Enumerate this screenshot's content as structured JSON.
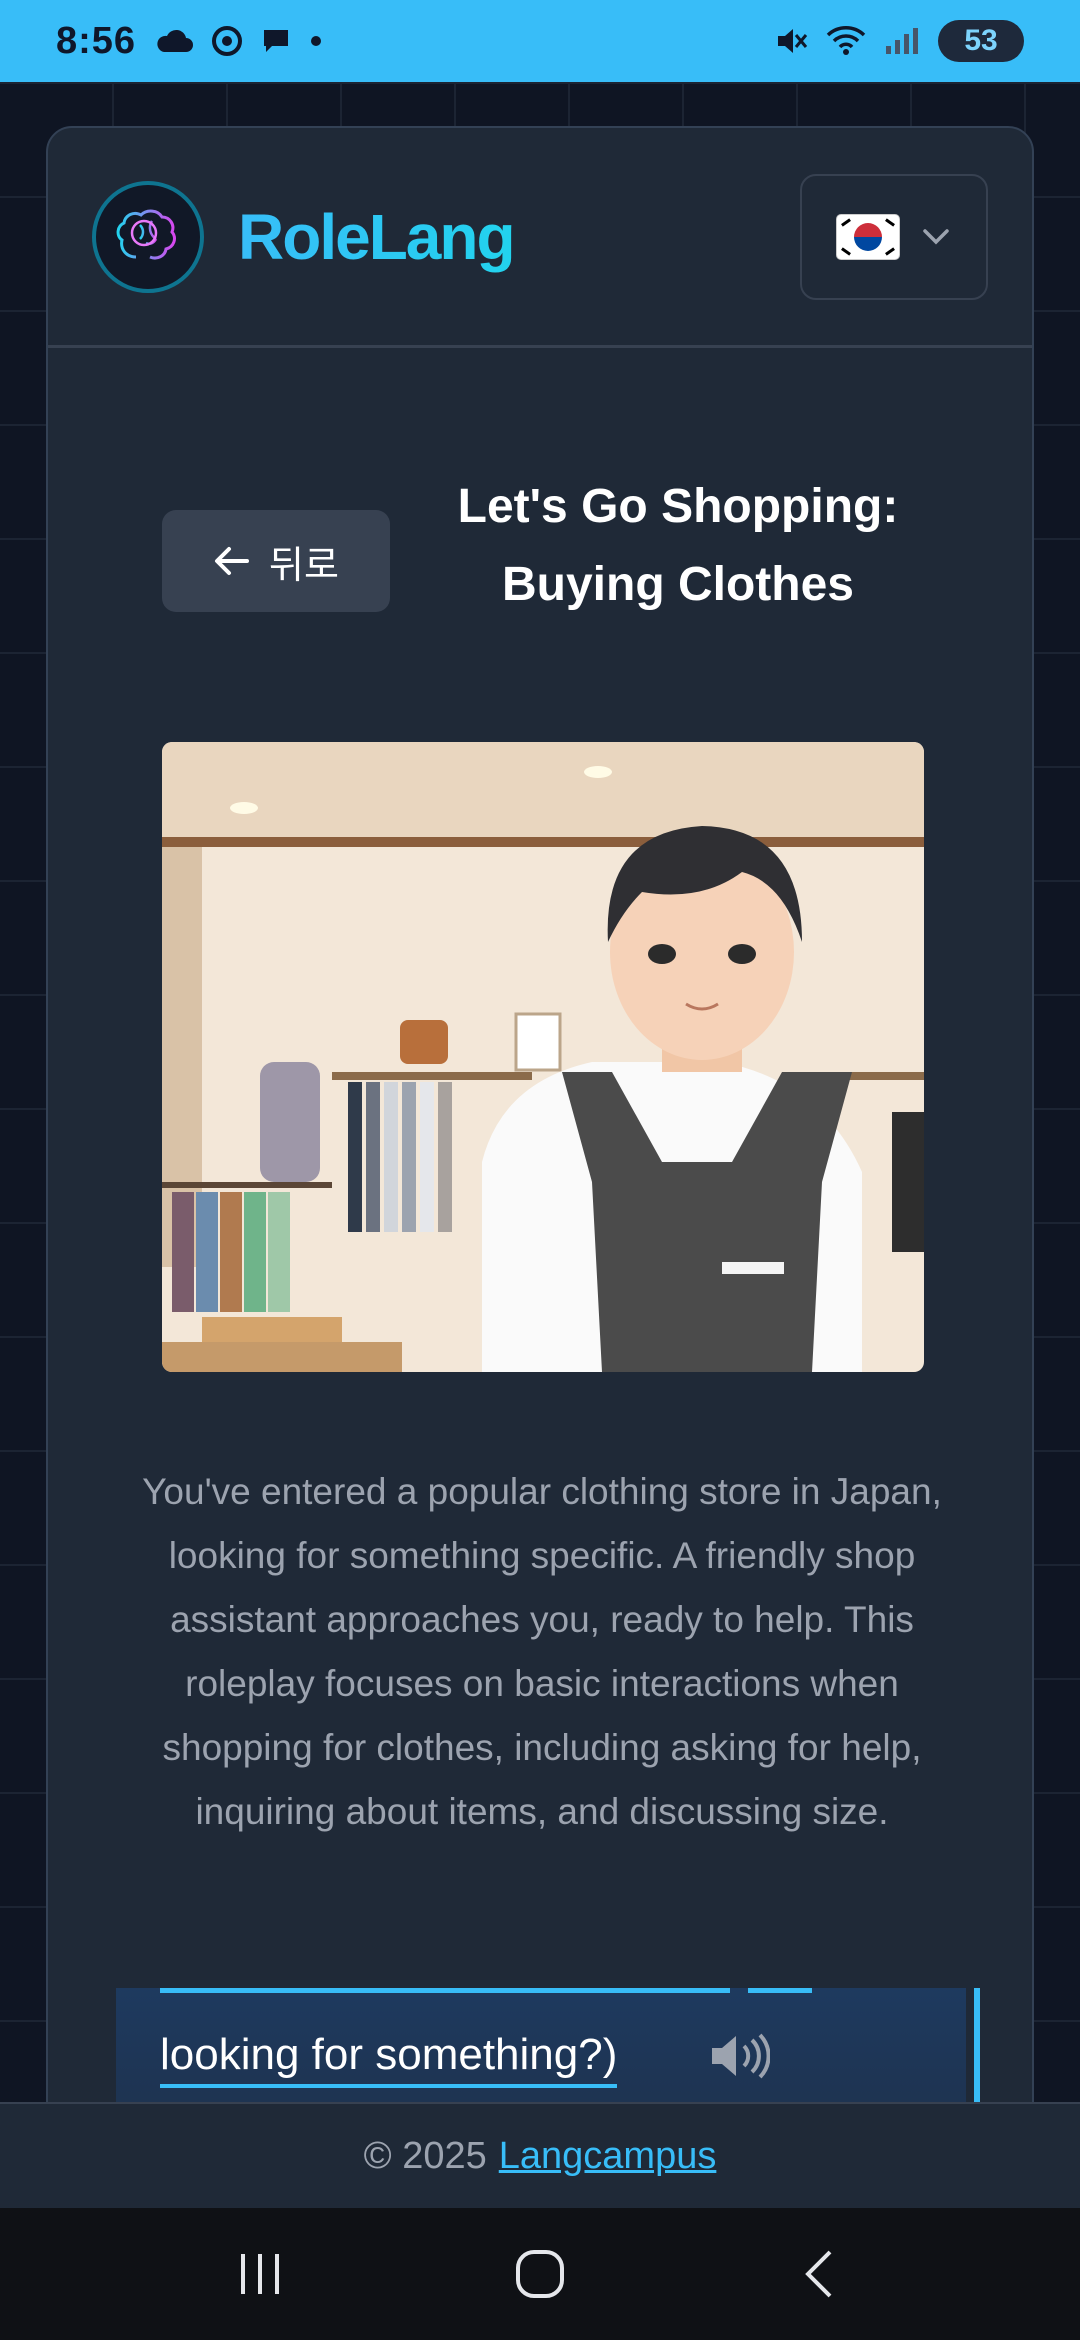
{
  "status_bar": {
    "time": "8:56",
    "battery": "53"
  },
  "header": {
    "brand": "RoleLang",
    "language_flag": "south-korea-flag"
  },
  "scenario": {
    "back_label": "뒤로",
    "title_line1": "Let's Go Shopping:",
    "title_line2": "Buying Clothes",
    "description": "You've entered a popular clothing store in Japan, looking for something specific. A friendly shop assistant approaches you, ready to help. This roleplay focuses on basic interactions when shopping for clothes, including asking for help, inquiring about items, and discussing size."
  },
  "dialog": {
    "visible_text": "looking for something?)"
  },
  "footer": {
    "copyright": "© 2025",
    "link": "Langcampus"
  },
  "colors": {
    "accent": "#38bdf8",
    "card_bg": "#1f2937",
    "page_bg": "#0f1523"
  }
}
